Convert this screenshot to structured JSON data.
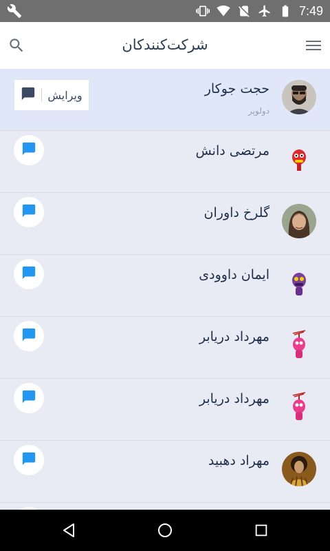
{
  "status_bar": {
    "time": "7:49"
  },
  "app_bar": {
    "title": "شرکت‌کنندکان"
  },
  "participants": [
    {
      "name": "حجت جوکار",
      "role": "دولوپر",
      "selected": true,
      "action_label": "ویرایش"
    },
    {
      "name": "مرتضی  دانش"
    },
    {
      "name": "گلرخ داوران"
    },
    {
      "name": "ایمان داوودی"
    },
    {
      "name": "مهرداد دریابر"
    },
    {
      "name": "مهرداد دریابر"
    },
    {
      "name": "مهراد دهبید"
    }
  ],
  "icons": {
    "status_left": "wrench-icon",
    "search": "search-icon",
    "menu": "hamburger-menu-icon",
    "message": "chat-bubble-icon"
  },
  "colors": {
    "accent": "#2196f3",
    "status_bar": "#6f6f6f",
    "list_background": "#e8ebf3",
    "selected_row": "#dfe7f8",
    "title_text": "#2c3e57"
  }
}
